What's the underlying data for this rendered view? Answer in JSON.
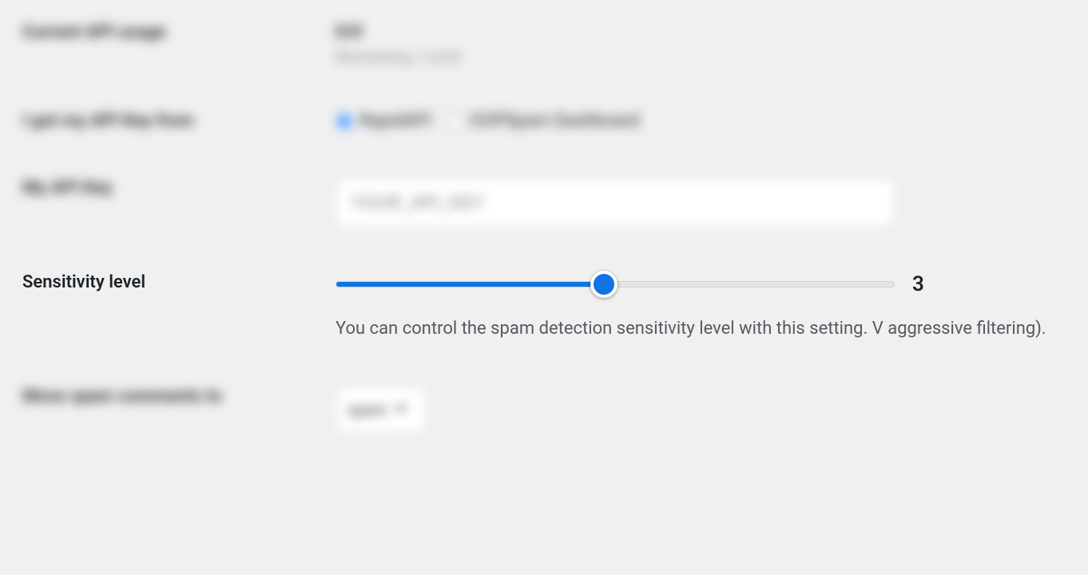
{
  "settings": {
    "api_usage": {
      "label": "Current API usage",
      "value": "0/0",
      "subtext": "Remaining / Limit"
    },
    "api_key_source": {
      "label": "I got my API Key from",
      "options": [
        {
          "value": "rapidapi",
          "label": "RapidAPI",
          "selected": true
        },
        {
          "value": "dashboard",
          "label": "OOPSpam Dashboard",
          "selected": false
        }
      ]
    },
    "api_key": {
      "label": "My API Key",
      "placeholder": "YOUR_API_KEY",
      "value": ""
    },
    "sensitivity": {
      "label": "Sensitivity level",
      "value": "3",
      "description": "You can control the spam detection sensitivity level with this setting. V aggressive filtering)."
    },
    "move_spam": {
      "label": "Move spam comments to",
      "selected": "spam"
    }
  }
}
